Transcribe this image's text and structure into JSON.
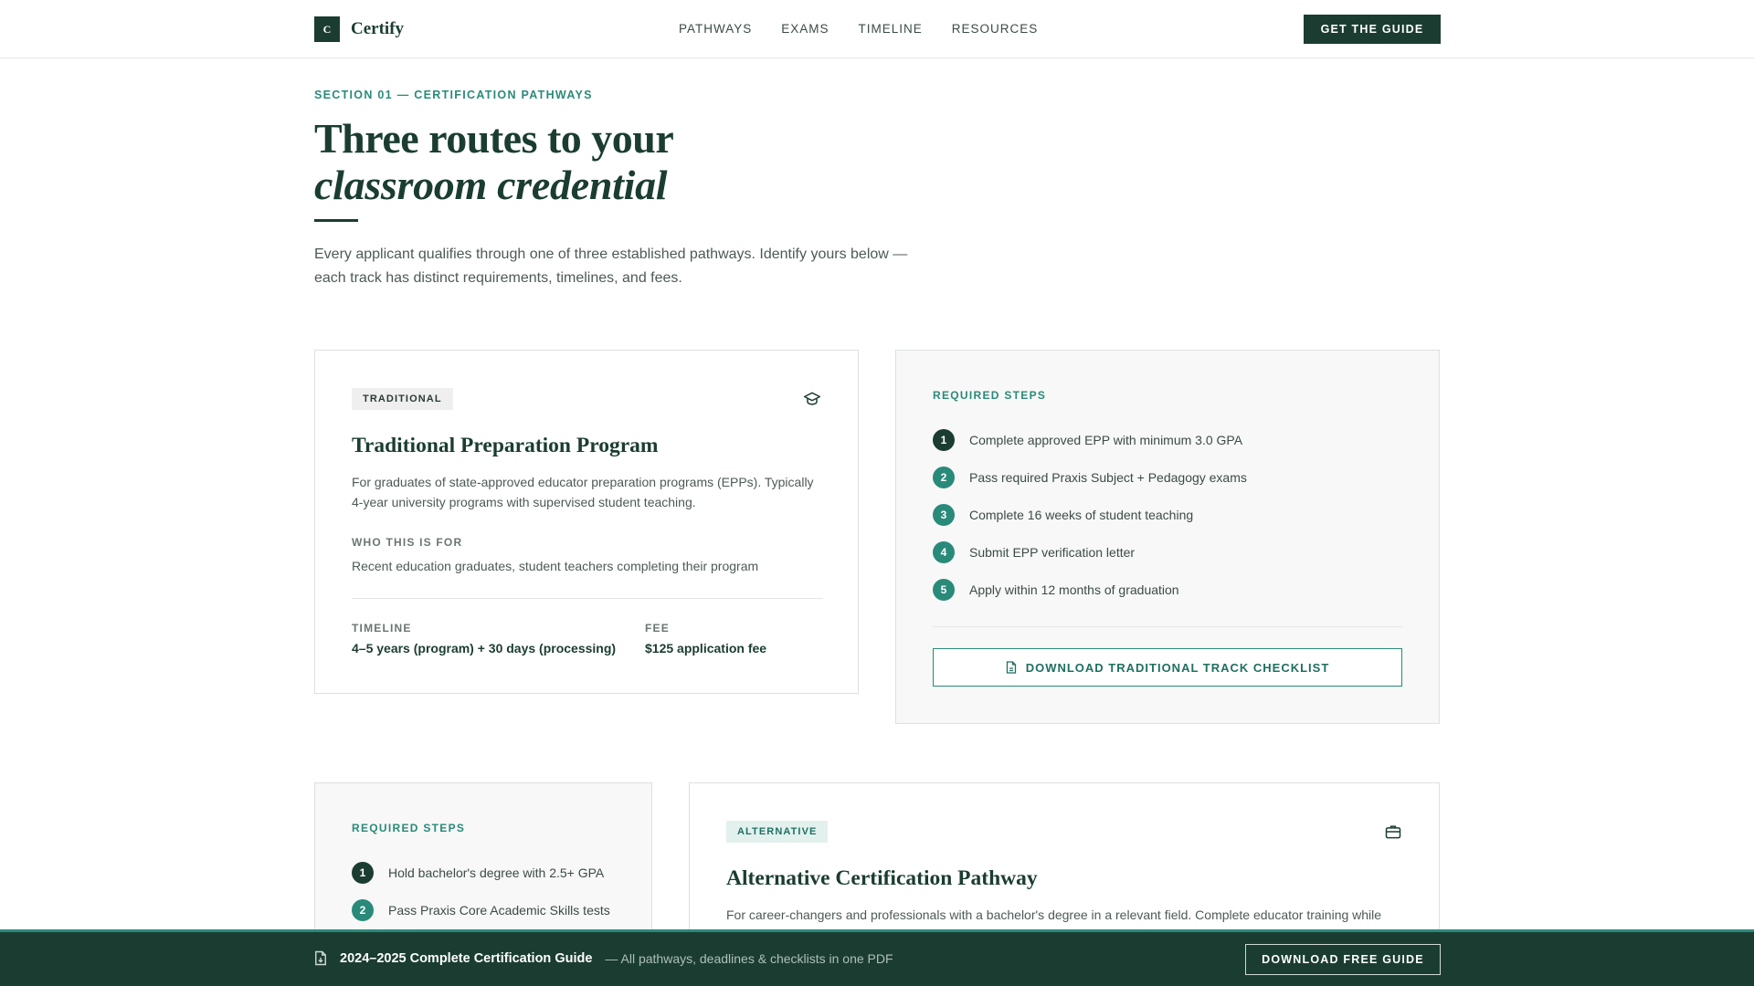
{
  "header": {
    "brand_mark": "C",
    "brand_name": "Certify",
    "nav": [
      "PATHWAYS",
      "EXAMS",
      "TIMELINE",
      "RESOURCES"
    ],
    "cta": "GET THE GUIDE"
  },
  "hero": {
    "eyebrow": "SECTION 01 — CERTIFICATION PATHWAYS",
    "title_line1": "Three routes to your",
    "title_line2": "classroom credential",
    "lede": "Every applicant qualifies through one of three established pathways. Identify yours below — each track has distinct requirements, timelines, and fees."
  },
  "traditional": {
    "badge": "TRADITIONAL",
    "icon": "graduation-cap-icon",
    "title": "Traditional Preparation Program",
    "description": "For graduates of state-approved educator preparation programs (EPPs). Typically 4-year university programs with supervised student teaching.",
    "who_label": "WHO THIS IS FOR",
    "who_text": "Recent education graduates, student teachers completing their program",
    "timeline_label": "TIMELINE",
    "timeline_value": "4–5 years (program) + 30 days (processing)",
    "fee_label": "FEE",
    "fee_value": "$125 application fee"
  },
  "traditional_steps": {
    "label": "REQUIRED STEPS",
    "items": [
      {
        "num": "1",
        "text": "Complete approved EPP with minimum 3.0 GPA"
      },
      {
        "num": "2",
        "text": "Pass required Praxis Subject + Pedagogy exams"
      },
      {
        "num": "3",
        "text": "Complete 16 weeks of student teaching"
      },
      {
        "num": "4",
        "text": "Submit EPP verification letter"
      },
      {
        "num": "5",
        "text": "Apply within 12 months of graduation"
      }
    ],
    "download_label": "DOWNLOAD TRADITIONAL TRACK CHECKLIST",
    "download_icon": "document-icon"
  },
  "alternative_steps": {
    "label": "REQUIRED STEPS",
    "items": [
      {
        "num": "1",
        "text": "Hold bachelor's degree with 2.5+ GPA"
      },
      {
        "num": "2",
        "text": "Pass Praxis Core Academic Skills tests"
      }
    ]
  },
  "alternative": {
    "badge": "ALTERNATIVE",
    "icon": "briefcase-icon",
    "title": "Alternative Certification Pathway",
    "description": "For career-changers and professionals with a bachelor's degree in a relevant field. Complete educator training while"
  },
  "bottom_bar": {
    "icon": "document-icon",
    "title": "2024–2025 Complete Certification Guide",
    "subtitle": "— All pathways, deadlines & checklists in one PDF",
    "button": "DOWNLOAD FREE GUIDE"
  },
  "colors": {
    "primary": "#1b3d31",
    "accent": "#2a8a7a",
    "tint": "#f7f8f7"
  }
}
